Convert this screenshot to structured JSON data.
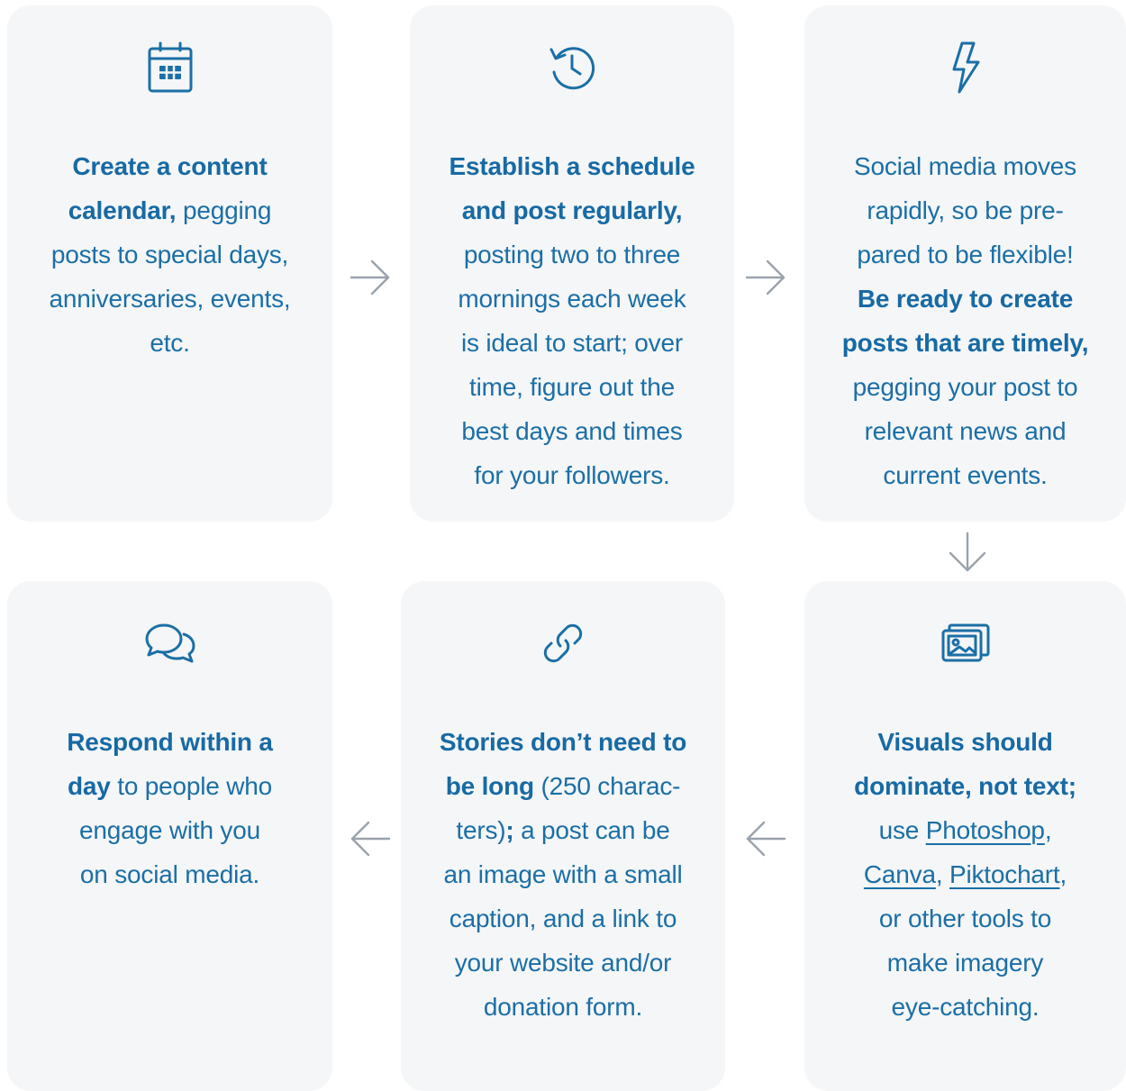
{
  "colors": {
    "accent": "#1b6fa6",
    "card_bg": "#f5f6f7",
    "arrow": "#9aa3ab"
  },
  "steps": [
    {
      "icon": "calendar-icon",
      "lines": [
        [
          {
            "t": "Create a content",
            "b": true
          }
        ],
        [
          {
            "t": "calendar,",
            "b": true
          },
          {
            "t": " pegging"
          }
        ],
        [
          {
            "t": "posts to special days,"
          }
        ],
        [
          {
            "t": "anniversaries, events,"
          }
        ],
        [
          {
            "t": "etc."
          }
        ]
      ]
    },
    {
      "icon": "history-clock-icon",
      "lines": [
        [
          {
            "t": "Establish a schedule",
            "b": true
          }
        ],
        [
          {
            "t": "and post regularly,",
            "b": true
          }
        ],
        [
          {
            "t": "posting two to three"
          }
        ],
        [
          {
            "t": "mornings each week"
          }
        ],
        [
          {
            "t": "is ideal to start; over"
          }
        ],
        [
          {
            "t": "time, figure out the"
          }
        ],
        [
          {
            "t": "best days and times"
          }
        ],
        [
          {
            "t": "for your followers."
          }
        ]
      ]
    },
    {
      "icon": "lightning-icon",
      "lines": [
        [
          {
            "t": "Social media moves"
          }
        ],
        [
          {
            "t": "rapidly, so be pre-"
          }
        ],
        [
          {
            "t": "pared to be flexible!"
          }
        ],
        [
          {
            "t": "Be ready to create",
            "b": true
          }
        ],
        [
          {
            "t": "posts that are timely,",
            "b": true
          }
        ],
        [
          {
            "t": "pegging your post to"
          }
        ],
        [
          {
            "t": "relevant news and"
          }
        ],
        [
          {
            "t": "current events."
          }
        ]
      ]
    },
    {
      "icon": "image-gallery-icon",
      "lines": [
        [
          {
            "t": "Visuals should",
            "b": true
          }
        ],
        [
          {
            "t": "dominate, not text;",
            "b": true
          }
        ],
        [
          {
            "t": "use "
          },
          {
            "t": "Photoshop",
            "u": true,
            "link": true
          },
          {
            "t": ","
          }
        ],
        [
          {
            "t": "Canva",
            "u": true,
            "link": true
          },
          {
            "t": ", "
          },
          {
            "t": "Piktochart",
            "u": true,
            "link": true
          },
          {
            "t": ","
          }
        ],
        [
          {
            "t": "or other tools to"
          }
        ],
        [
          {
            "t": "make imagery"
          }
        ],
        [
          {
            "t": "eye-catching."
          }
        ]
      ]
    },
    {
      "icon": "link-icon",
      "lines": [
        [
          {
            "t": "Stories don’t need to",
            "b": true
          }
        ],
        [
          {
            "t": "be long",
            "b": true
          },
          {
            "t": " (250 charac-"
          }
        ],
        [
          {
            "t": "ters)"
          },
          {
            "t": ";",
            "b": true
          },
          {
            "t": " a post can be"
          }
        ],
        [
          {
            "t": "an image with a small"
          }
        ],
        [
          {
            "t": "caption, and a link to"
          }
        ],
        [
          {
            "t": "your website and/or"
          }
        ],
        [
          {
            "t": "donation form."
          }
        ]
      ]
    },
    {
      "icon": "chat-bubbles-icon",
      "lines": [
        [
          {
            "t": "Respond within a",
            "b": true
          }
        ],
        [
          {
            "t": "day",
            "b": true
          },
          {
            "t": " to people who"
          }
        ],
        [
          {
            "t": "engage with you"
          }
        ],
        [
          {
            "t": "on social media."
          }
        ]
      ]
    }
  ],
  "arrows": [
    {
      "dir": "right",
      "name": "arrow-right-icon"
    },
    {
      "dir": "right",
      "name": "arrow-right-icon"
    },
    {
      "dir": "down",
      "name": "arrow-down-icon"
    },
    {
      "dir": "left",
      "name": "arrow-left-icon"
    },
    {
      "dir": "left",
      "name": "arrow-left-icon"
    }
  ]
}
